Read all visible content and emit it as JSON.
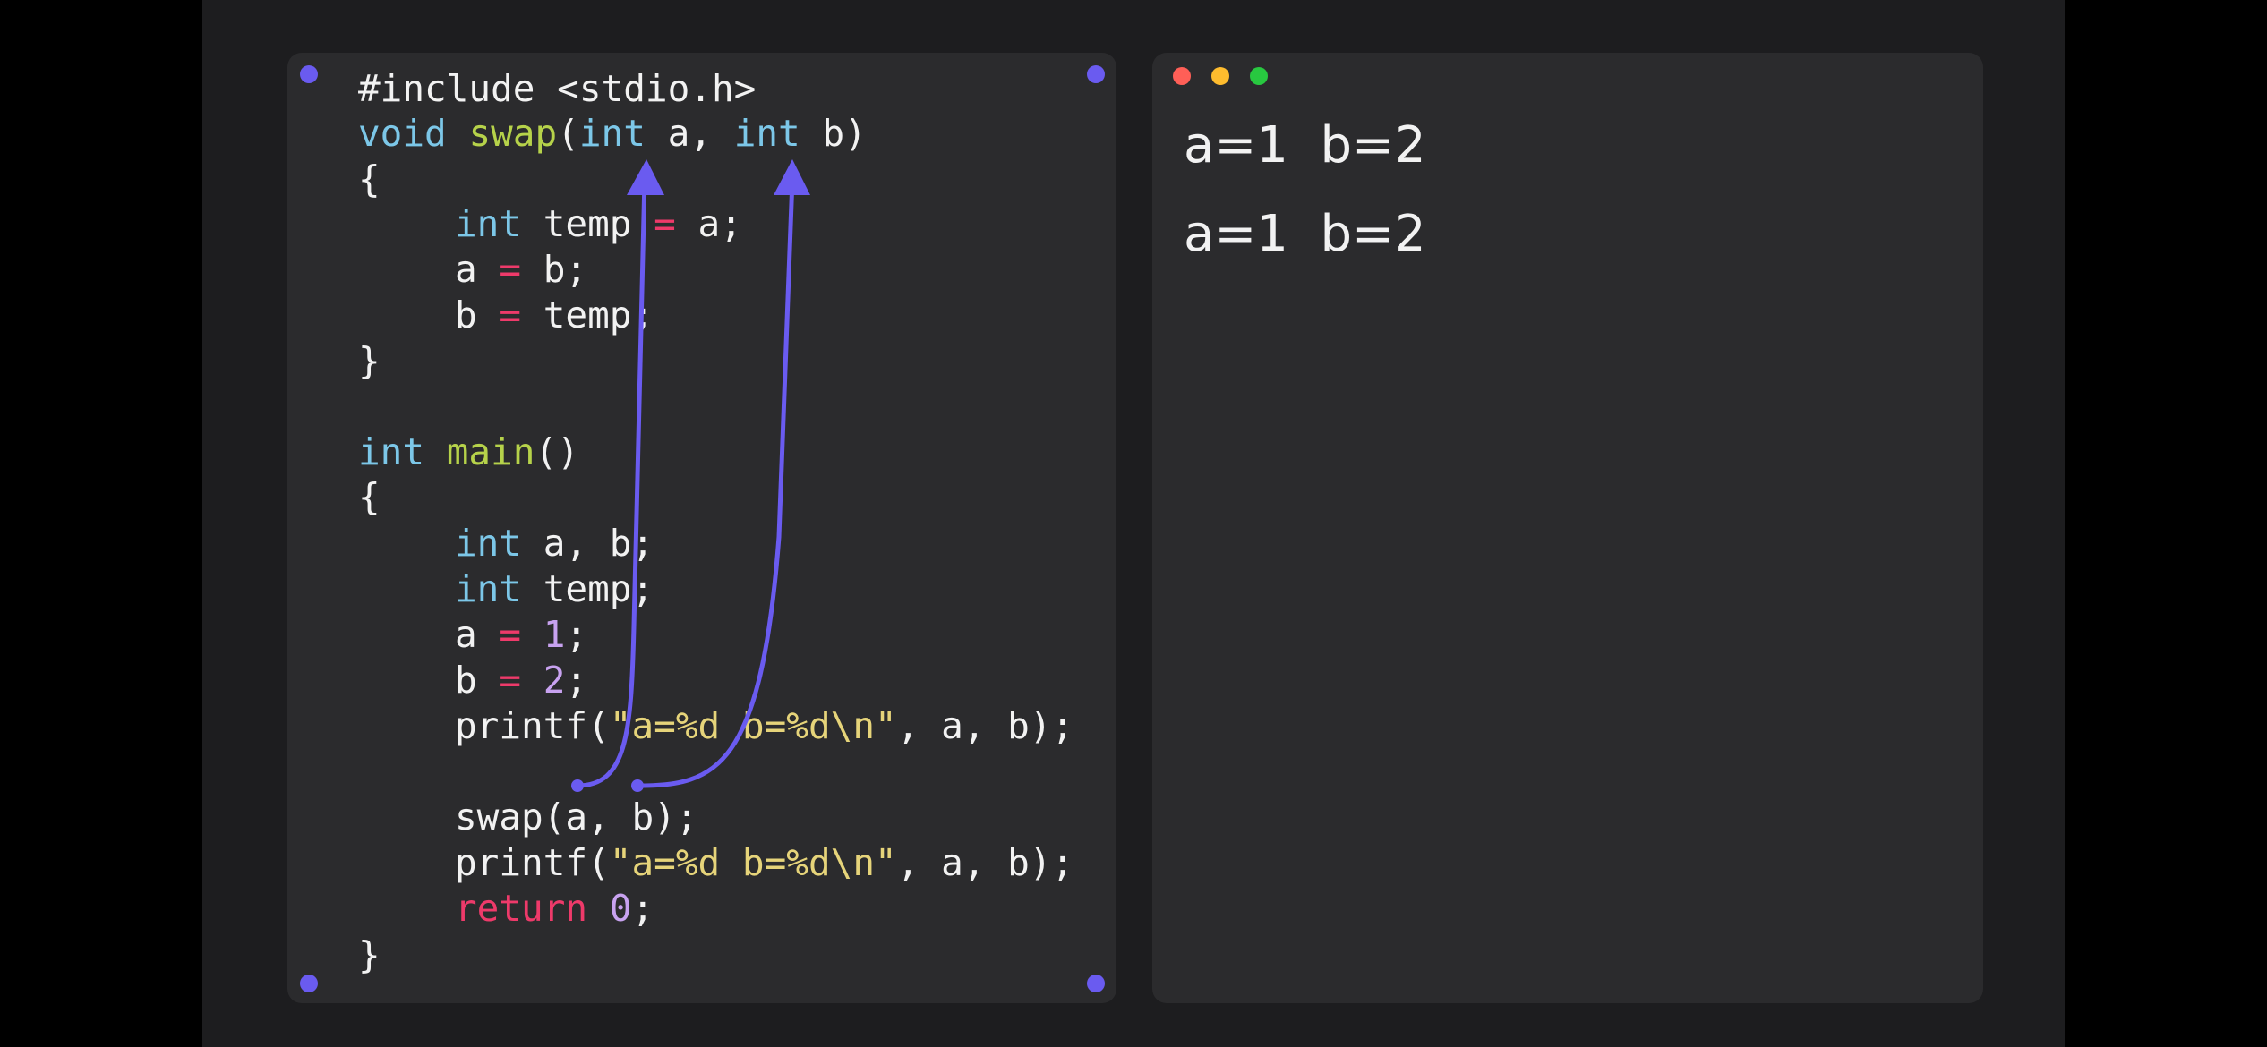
{
  "code": {
    "line1": "#include <stdio.h>",
    "line2": {
      "void": "void",
      "fn": "swap",
      "open": "(",
      "int1": "int",
      "a": " a, ",
      "int2": "int",
      "b": " b)"
    },
    "line3": "{",
    "line4": {
      "int": "int",
      "temp": " temp ",
      "eq": "=",
      "rest": " a;"
    },
    "line5": {
      "a": "a ",
      "eq": "=",
      "rest": " b;"
    },
    "line6": {
      "b": "b ",
      "eq": "=",
      "rest": " temp;"
    },
    "line7": "}",
    "line8": {
      "int": "int",
      "fn": " main",
      "rest": "()"
    },
    "line9": "{",
    "line10": {
      "int": "int",
      "rest": " a, b;"
    },
    "line11": {
      "int": "int",
      "rest": " temp;"
    },
    "line12": {
      "a": "a ",
      "eq": "=",
      "sp": " ",
      "num": "1",
      "semi": ";"
    },
    "line13": {
      "b": "b ",
      "eq": "=",
      "sp": " ",
      "num": "2",
      "semi": ";"
    },
    "line14": {
      "fn": "printf(",
      "str": "\"a=%d b=%d\\n\"",
      "rest": ", a, b);"
    },
    "line15": "swap(a, b);",
    "line16": {
      "fn": "printf(",
      "str": "\"a=%d b=%d\\n\"",
      "rest": ", a, b);"
    },
    "line17": {
      "ret": "return",
      "sp": " ",
      "num": "0",
      "semi": ";"
    },
    "line18": "}"
  },
  "output": {
    "line1": "a=1  b=2",
    "line2": "a=1  b=2"
  },
  "colors": {
    "window_close": "#ff5f57",
    "window_minimize": "#febc2e",
    "window_maximize": "#28c840",
    "arrow": "#6a5bf0"
  }
}
